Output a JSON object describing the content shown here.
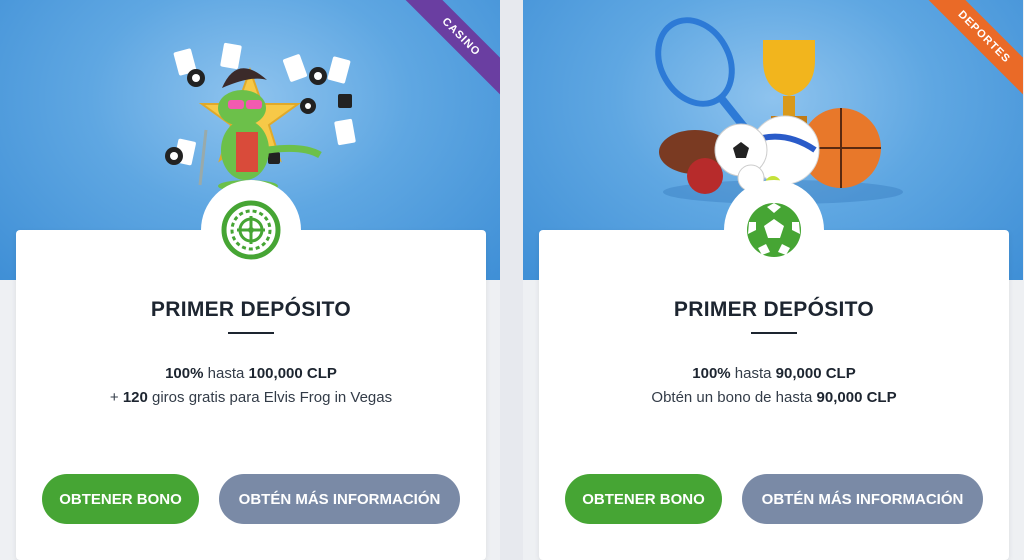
{
  "colors": {
    "hero_blue": "#4f9de0",
    "casino_ribbon": "#6a3ea1",
    "sports_ribbon": "#ea6a27",
    "green_button": "#46a534",
    "grey_button": "#7a8aa6",
    "icon_green": "#46a534"
  },
  "cards": [
    {
      "ribbon": "CASINO",
      "icon": "roulette-wheel-icon",
      "title": "PRIMER DEPÓSITO",
      "line1": {
        "pct": "100%",
        "mid": " hasta ",
        "amount": "100,000 CLP"
      },
      "line2": {
        "pre": "+ ",
        "bold": "120",
        "post": " giros gratis para Elvis Frog in Vegas"
      },
      "primary_button": "OBTENER BONO",
      "secondary_button": "OBTÉN MÁS INFORMACIÓN"
    },
    {
      "ribbon": "DEPORTES",
      "icon": "soccer-ball-icon",
      "title": "PRIMER DEPÓSITO",
      "line1": {
        "pct": "100%",
        "mid": " hasta ",
        "amount": "90,000 CLP"
      },
      "line2": {
        "pre": "Obtén un bono de hasta ",
        "bold": "90,000 CLP",
        "post": ""
      },
      "primary_button": "OBTENER BONO",
      "secondary_button": "OBTÉN MÁS INFORMACIÓN"
    }
  ]
}
